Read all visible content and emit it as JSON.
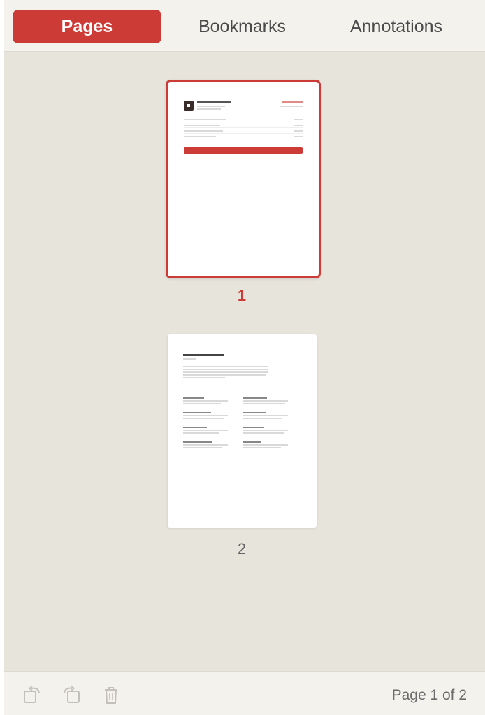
{
  "tabs": [
    {
      "label": "Pages",
      "active": true
    },
    {
      "label": "Bookmarks",
      "active": false
    },
    {
      "label": "Annotations",
      "active": false
    }
  ],
  "thumbnails": [
    {
      "page_label": "1",
      "selected": true
    },
    {
      "page_label": "2",
      "selected": false
    }
  ],
  "toolbar": {
    "rotate_left_icon": "rotate-left-icon",
    "rotate_right_icon": "rotate-right-icon",
    "delete_icon": "trash-icon",
    "status": "Page 1 of 2"
  },
  "colors": {
    "accent": "#cc3b36",
    "panel_bg": "#e7e4dc",
    "bar_bg": "#f4f2ec"
  }
}
